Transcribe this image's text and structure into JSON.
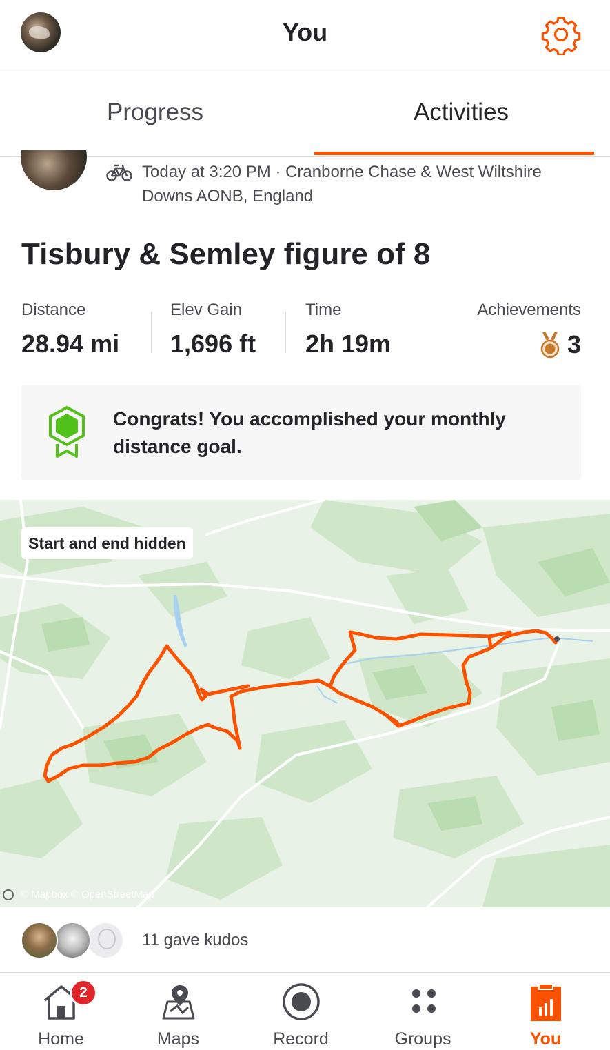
{
  "header": {
    "title": "You"
  },
  "tabs": [
    {
      "label": "Progress"
    },
    {
      "label": "Activities"
    }
  ],
  "activity": {
    "meta": "Today at 3:20 PM · Cranborne Chase & West Wiltshire Downs AONB, England",
    "title": "Tisbury & Semley figure of 8",
    "stats": [
      {
        "label": "Distance",
        "value": "28.94 mi"
      },
      {
        "label": "Elev Gain",
        "value": "1,696 ft"
      },
      {
        "label": "Time",
        "value": "2h 19m"
      }
    ],
    "achievements": {
      "label": "Achievements",
      "value": "3"
    },
    "goal_message": "Congrats! You accomplished your monthly distance goal.",
    "map": {
      "hidden_label": "Start and end hidden",
      "attribution": "© Mapbox © OpenStreetMap"
    },
    "kudos": "11 gave kudos"
  },
  "nav": [
    {
      "label": "Home",
      "badge": "2"
    },
    {
      "label": "Maps"
    },
    {
      "label": "Record"
    },
    {
      "label": "Groups"
    },
    {
      "label": "You"
    }
  ],
  "colors": {
    "accent": "#fc5200",
    "badge": "#e0262b",
    "goal": "#52c21a",
    "medal": "#c8782c"
  }
}
